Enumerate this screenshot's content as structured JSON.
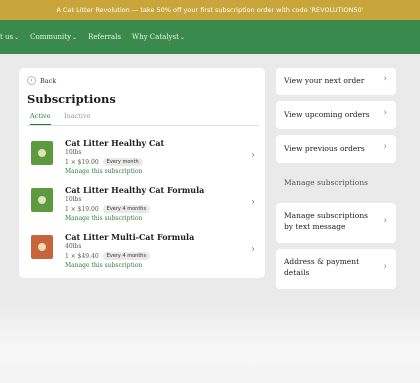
{
  "promo": {
    "text": "A Cat Litter Revolution — take 50% off your first subscription order with code 'REVOLUTION50'"
  },
  "nav": {
    "items": [
      {
        "label": "t us",
        "chevron": "⌄"
      },
      {
        "label": "Community",
        "chevron": "⌄"
      },
      {
        "label": "Referrals",
        "chevron": ""
      },
      {
        "label": "Why Catalyst",
        "chevron": "⌄"
      }
    ]
  },
  "main": {
    "back_label": "Back",
    "back_icon": "‹",
    "title": "Subscriptions",
    "tabs": [
      {
        "label": "Active"
      },
      {
        "label": "Inactive"
      }
    ],
    "subscriptions": [
      {
        "name": "Cat Litter Healthy Cat",
        "size": "10lbs",
        "qty_price": "1 × $19.00",
        "frequency": "Every month",
        "manage": "Manage this subscription",
        "bag_color": "#5b9a3e"
      },
      {
        "name": "Cat Litter Healthy Cat Formula",
        "size": "10lbs",
        "qty_price": "1 × $19.00",
        "frequency": "Every 4 months",
        "manage": "Manage this subscription",
        "bag_color": "#5b9a3e"
      },
      {
        "name": "Cat Litter Multi-Cat Formula",
        "size": "40lbs",
        "qty_price": "1 × $49.40",
        "frequency": "Every 4 months",
        "manage": "Manage this subscription",
        "bag_color": "#c8643a"
      }
    ]
  },
  "side": {
    "next_order": "View your next order",
    "upcoming_orders": "View upcoming orders",
    "previous_orders": "View previous orders",
    "manage_subscriptions": "Manage subscriptions",
    "manage_by_text": "Manage subscriptions by text message",
    "address_payment": "Address & payment details",
    "chevron": "›"
  }
}
